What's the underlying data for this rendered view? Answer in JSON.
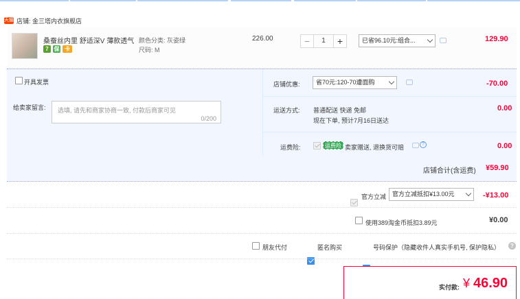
{
  "shop": {
    "badge": "天猫",
    "name": "店铺: 金三塔内衣旗舰店"
  },
  "item": {
    "title": "桑蚕丝内里 舒适深V 薄款透气...",
    "sku_color": "颜色分类: 灰姿绿",
    "sku_size": "尺码: M",
    "unit_price": "226.00",
    "quantity": "1",
    "minus": "−",
    "plus": "+",
    "promo_select": "已省96.10元:组合...",
    "subtotal": "129.90",
    "service_icons": [
      "7",
      "保",
      "卡"
    ]
  },
  "options": {
    "invoice_label": "开具发票",
    "message_label": "给卖家留言:",
    "message_placeholder": "选填, 请先和商家协商一致, 付款后商家可见",
    "message_count": "0/200"
  },
  "shop_discount": {
    "label": "店铺优惠:",
    "select": "省70元:120-70遭面购",
    "amount": "-70.00"
  },
  "shipping": {
    "label": "运送方式:",
    "line1": "普通配送 快递 免邮",
    "line2": "现在下单, 预计7月16日送达",
    "amount": "0.00"
  },
  "insurance": {
    "label": "运费险:",
    "tag": "运费险",
    "text": "卖家赠送, 退换货可赔",
    "amount": "0.00"
  },
  "shop_total": {
    "label": "店铺合计(含运费)",
    "amount": "¥59.90"
  },
  "official_discount": {
    "label": "官方立减",
    "select": "官方立减抵扣¥13.00元",
    "amount": "-¥13.00"
  },
  "coins": {
    "label": "使用389淘金币抵扣3.89元",
    "amount": "¥0.00"
  },
  "extras": {
    "friend_pay": "朋友代付",
    "anonymous": "匿名购买",
    "number_protect": "号码保护（隐藏收件人真实手机号, 保护隐私）",
    "help": "?"
  },
  "payment": {
    "label": "实付款:",
    "currency": "¥",
    "amount": "46.90"
  },
  "colors": {
    "accent": "#ff0036",
    "panel_bg": "#f2f7ff",
    "checkbox_on": "#3c8fe8"
  }
}
